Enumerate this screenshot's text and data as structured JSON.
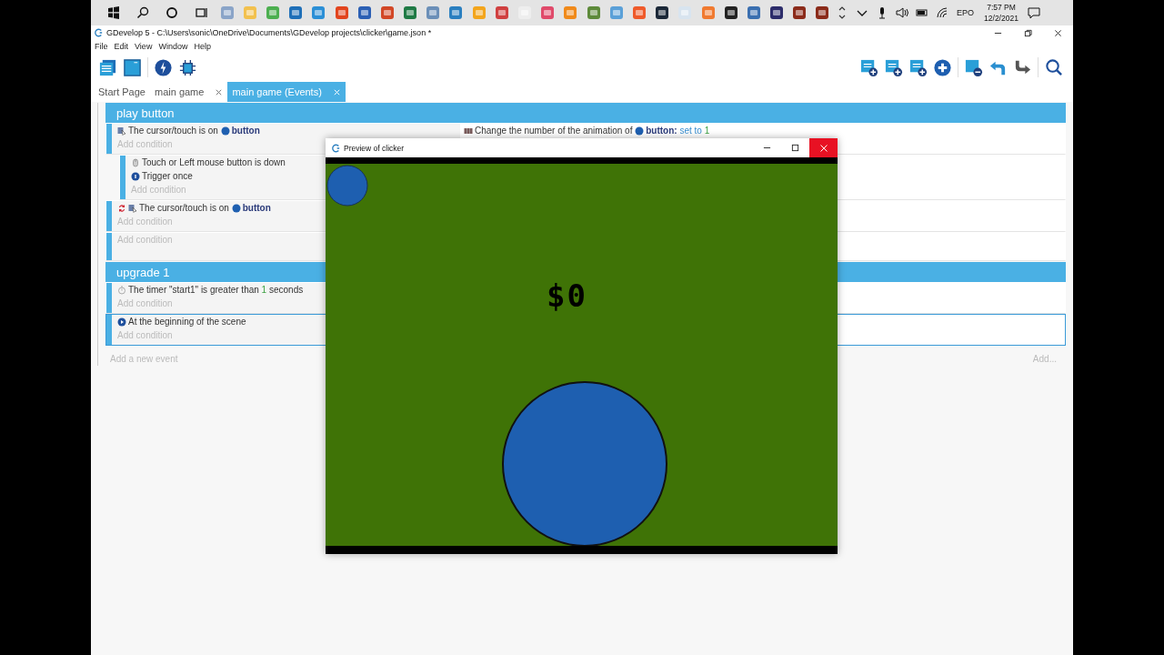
{
  "taskbar": {
    "language": "EPO",
    "time": "7:57 PM",
    "date": "12/2/2021"
  },
  "window": {
    "title": "GDevelop 5 - C:\\Users\\sonic\\OneDrive\\Documents\\GDevelop projects\\clicker\\game.json *",
    "menu": [
      "File",
      "Edit",
      "View",
      "Window",
      "Help"
    ]
  },
  "tabs": [
    {
      "label": "Start Page",
      "selected": false,
      "closable": false
    },
    {
      "label": "main game",
      "selected": false,
      "closable": true
    },
    {
      "label": "main game (Events)",
      "selected": true,
      "closable": true
    }
  ],
  "events": [
    {
      "kind": "group",
      "title": "play button",
      "selected": false
    },
    {
      "kind": "event",
      "selected": false,
      "add_label": "Add condition",
      "conditions": [
        {
          "kind": "cursor",
          "inverted": false,
          "segments": [
            {
              "text": "The cursor/touch is on "
            },
            {
              "text": "button",
              "kind": "object"
            }
          ]
        }
      ],
      "actions": [
        {
          "segments": [
            {
              "text": "Change the number of the animation of "
            },
            {
              "text": "button:",
              "kind": "object"
            },
            {
              "text": " set to ",
              "kind": "value"
            },
            {
              "text": "1",
              "kind": "number"
            }
          ]
        }
      ],
      "children": [
        {
          "kind": "event",
          "selected": false,
          "add_label": "Add condition",
          "conditions": [
            {
              "kind": "mouse",
              "inverted": false,
              "segments": [
                {
                  "text": "Touch or Left mouse button is down"
                }
              ]
            },
            {
              "kind": "once",
              "inverted": false,
              "segments": [
                {
                  "text": "Trigger once"
                }
              ]
            }
          ]
        }
      ]
    },
    {
      "kind": "event",
      "selected": false,
      "add_label": "Add condition",
      "conditions": [
        {
          "kind": "cursor",
          "inverted": true,
          "segments": [
            {
              "text": "The cursor/touch is on "
            },
            {
              "text": "button",
              "kind": "object"
            }
          ]
        }
      ]
    },
    {
      "kind": "event",
      "selected": false,
      "add_label": "Add condition"
    },
    {
      "kind": "group",
      "title": "upgrade 1",
      "selected": false
    },
    {
      "kind": "event",
      "selected": false,
      "add_label": "Add condition",
      "conditions": [
        {
          "kind": "timer",
          "inverted": false,
          "segments": [
            {
              "text": "The timer \"start1\" is greater than "
            },
            {
              "text": "1",
              "kind": "number"
            },
            {
              "text": " seconds"
            }
          ]
        }
      ]
    },
    {
      "kind": "event",
      "selected": true,
      "add_label": "Add condition",
      "conditions": [
        {
          "kind": "scene",
          "inverted": false,
          "segments": [
            {
              "text": "At the beginning of the scene"
            }
          ]
        }
      ]
    }
  ],
  "add_event": "Add a new event",
  "add_more": "Add...",
  "preview": {
    "title": "Preview of clicker",
    "score": "$0"
  }
}
